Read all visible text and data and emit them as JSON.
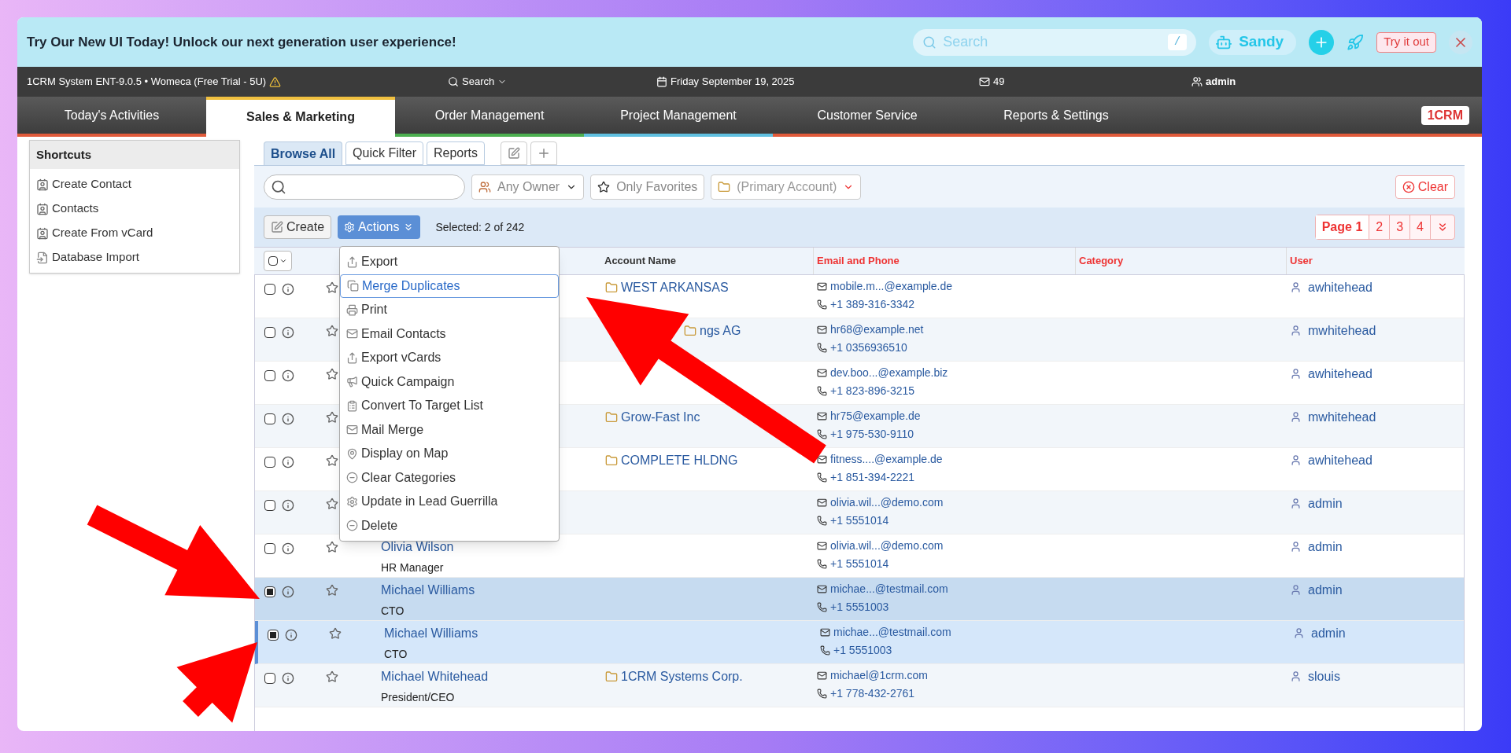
{
  "banner": {
    "text": "Try Our New UI Today! Unlock our next generation user experience!",
    "search": {
      "placeholder": "Search",
      "shortcut": "/"
    },
    "user": "Sandy",
    "try_button": "Try it out"
  },
  "top_bar": {
    "system": "1CRM System ENT-9.0.5 • Womeca (Free Trial - 5U)",
    "search": "Search",
    "date": "Friday September 19, 2025",
    "mail_count": "49",
    "user": "admin"
  },
  "nav": {
    "tabs": [
      {
        "label": "Today's Activities",
        "selected": false
      },
      {
        "label": "Sales & Marketing",
        "selected": true
      },
      {
        "label": "Order Management",
        "selected": false
      },
      {
        "label": "Project Management",
        "selected": false
      },
      {
        "label": "Customer Service",
        "selected": false
      },
      {
        "label": "Reports & Settings",
        "selected": false
      }
    ],
    "logo": "1CRM"
  },
  "sidebar": {
    "title": "Shortcuts",
    "items": [
      {
        "label": "Create Contact",
        "kind": "create"
      },
      {
        "label": "Contacts",
        "kind": "list"
      },
      {
        "label": "Create From vCard",
        "kind": "create"
      },
      {
        "label": "Database Import",
        "kind": "import"
      }
    ]
  },
  "view_tabs": [
    {
      "label": "Browse All",
      "selected": true
    },
    {
      "label": "Quick Filter",
      "selected": false
    },
    {
      "label": "Reports",
      "selected": false
    }
  ],
  "filters": {
    "owner": "Any Owner",
    "favorites": "Only Favorites",
    "account": "(Primary Account)",
    "clear": "Clear"
  },
  "toolbar": {
    "create": "Create",
    "actions": "Actions",
    "selected_info": "Selected: 2 of 242",
    "pages": [
      {
        "label": "Page 1",
        "selected": true
      },
      {
        "label": "2",
        "selected": false
      },
      {
        "label": "3",
        "selected": false
      },
      {
        "label": "4",
        "selected": false
      }
    ]
  },
  "actions_menu": [
    {
      "label": "Export",
      "selected": false
    },
    {
      "label": "Merge Duplicates",
      "selected": true
    },
    {
      "label": "Print",
      "selected": false
    },
    {
      "label": "Email Contacts",
      "selected": false
    },
    {
      "label": "Export vCards",
      "selected": false
    },
    {
      "label": "Quick Campaign",
      "selected": false
    },
    {
      "label": "Convert To Target List",
      "selected": false
    },
    {
      "label": "Mail Merge",
      "selected": false
    },
    {
      "label": "Display on Map",
      "selected": false
    },
    {
      "label": "Clear Categories",
      "selected": false
    },
    {
      "label": "Update in Lead Guerrilla",
      "selected": false
    },
    {
      "label": "Delete",
      "selected": false
    }
  ],
  "table": {
    "columns": [
      "Account Name",
      "Email and Phone",
      "Category",
      "User"
    ],
    "rows": [
      {
        "account": "WEST ARKANSAS",
        "email": "mobile.m...@example.de",
        "phone": "+1 389-316-3342",
        "user": "awhitehead",
        "checked": false,
        "selected": false
      },
      {
        "account": "ngs AG",
        "email": "hr68@example.net",
        "phone": "+1 0356936510",
        "user": "mwhitehead",
        "checked": false,
        "selected": false
      },
      {
        "email": "dev.boo...@example.biz",
        "phone": "+1 823-896-3215",
        "user": "awhitehead",
        "checked": false,
        "selected": false
      },
      {
        "account": "Grow-Fast Inc",
        "email": "hr75@example.de",
        "phone": "+1 975-530-9110",
        "user": "mwhitehead",
        "checked": false,
        "selected": false
      },
      {
        "account": "COMPLETE HLDNG",
        "email": "fitness....@example.de",
        "phone": "+1 851-394-2221",
        "user": "awhitehead",
        "checked": false,
        "selected": false
      },
      {
        "email": "olivia.wil...@demo.com",
        "phone": "+1 5551014",
        "user": "admin",
        "checked": false,
        "selected": false
      },
      {
        "name": "Olivia Wilson",
        "title": "HR Manager",
        "email": "olivia.wil...@demo.com",
        "phone": "+1 5551014",
        "user": "admin",
        "checked": false,
        "selected": false
      },
      {
        "name": "Michael Williams",
        "title": "CTO",
        "email": "michae...@testmail.com",
        "phone": "+1 5551003",
        "user": "admin",
        "checked": true,
        "selected": false
      },
      {
        "name": "Michael Williams",
        "title": "CTO",
        "email": "michae...@testmail.com",
        "phone": "+1 5551003",
        "user": "admin",
        "checked": true,
        "selected": true
      },
      {
        "name": "Michael Whitehead",
        "title": "President/CEO",
        "account": "1CRM Systems Corp.",
        "email": "michael@1crm.com",
        "phone": "+1 778-432-2761",
        "user": "slouis",
        "checked": false,
        "selected": false
      }
    ]
  }
}
